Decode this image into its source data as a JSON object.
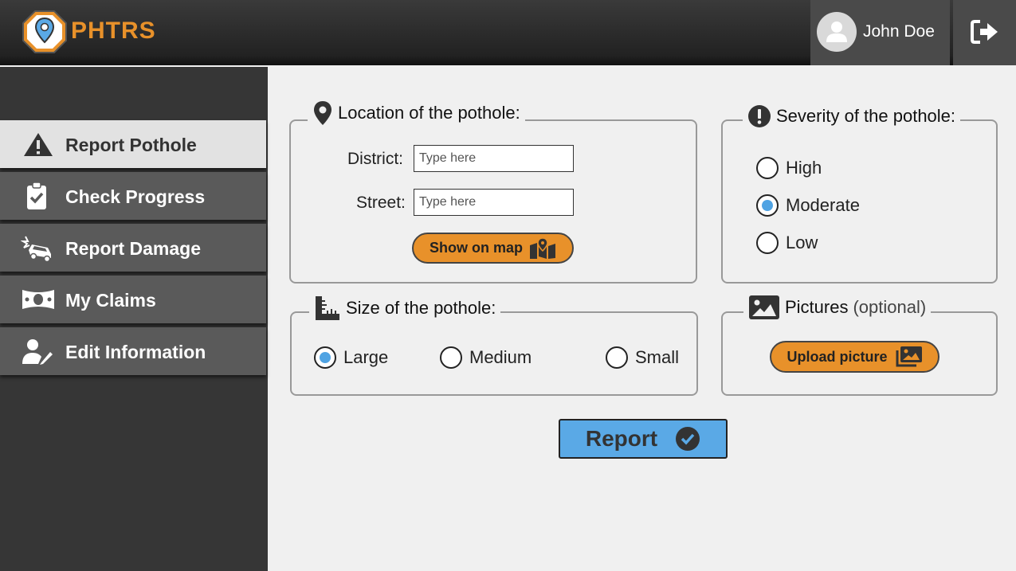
{
  "app": {
    "brand": "PHTRS",
    "accent": "#e8912a",
    "highlight": "#5aa9e6"
  },
  "header": {
    "username": "John Doe",
    "logout_icon": "sign-out-icon",
    "avatar_icon": "user-avatar-icon"
  },
  "sidebar": {
    "items": [
      {
        "label": "Report Pothole",
        "icon": "warning-triangle-icon",
        "active": true
      },
      {
        "label": "Check Progress",
        "icon": "clipboard-check-icon",
        "active": false
      },
      {
        "label": "Report Damage",
        "icon": "car-crash-icon",
        "active": false
      },
      {
        "label": "My Claims",
        "icon": "money-bill-icon",
        "active": false
      },
      {
        "label": "Edit Information",
        "icon": "user-edit-icon",
        "active": false
      }
    ]
  },
  "location": {
    "title": "Location of the pothole:",
    "district_label": "District:",
    "district_placeholder": "Type here",
    "street_label": "Street:",
    "street_placeholder": "Type here",
    "map_button": "Show on map"
  },
  "severity": {
    "title": "Severity of the pothole:",
    "options": [
      "High",
      "Moderate",
      "Low"
    ],
    "selected": "Moderate"
  },
  "size": {
    "title": "Size of the pothole:",
    "options": [
      "Large",
      "Medium",
      "Small"
    ],
    "selected": "Large"
  },
  "pictures": {
    "title": "Pictures",
    "optional": "(optional)",
    "upload_button": "Upload picture"
  },
  "submit": {
    "label": "Report"
  }
}
